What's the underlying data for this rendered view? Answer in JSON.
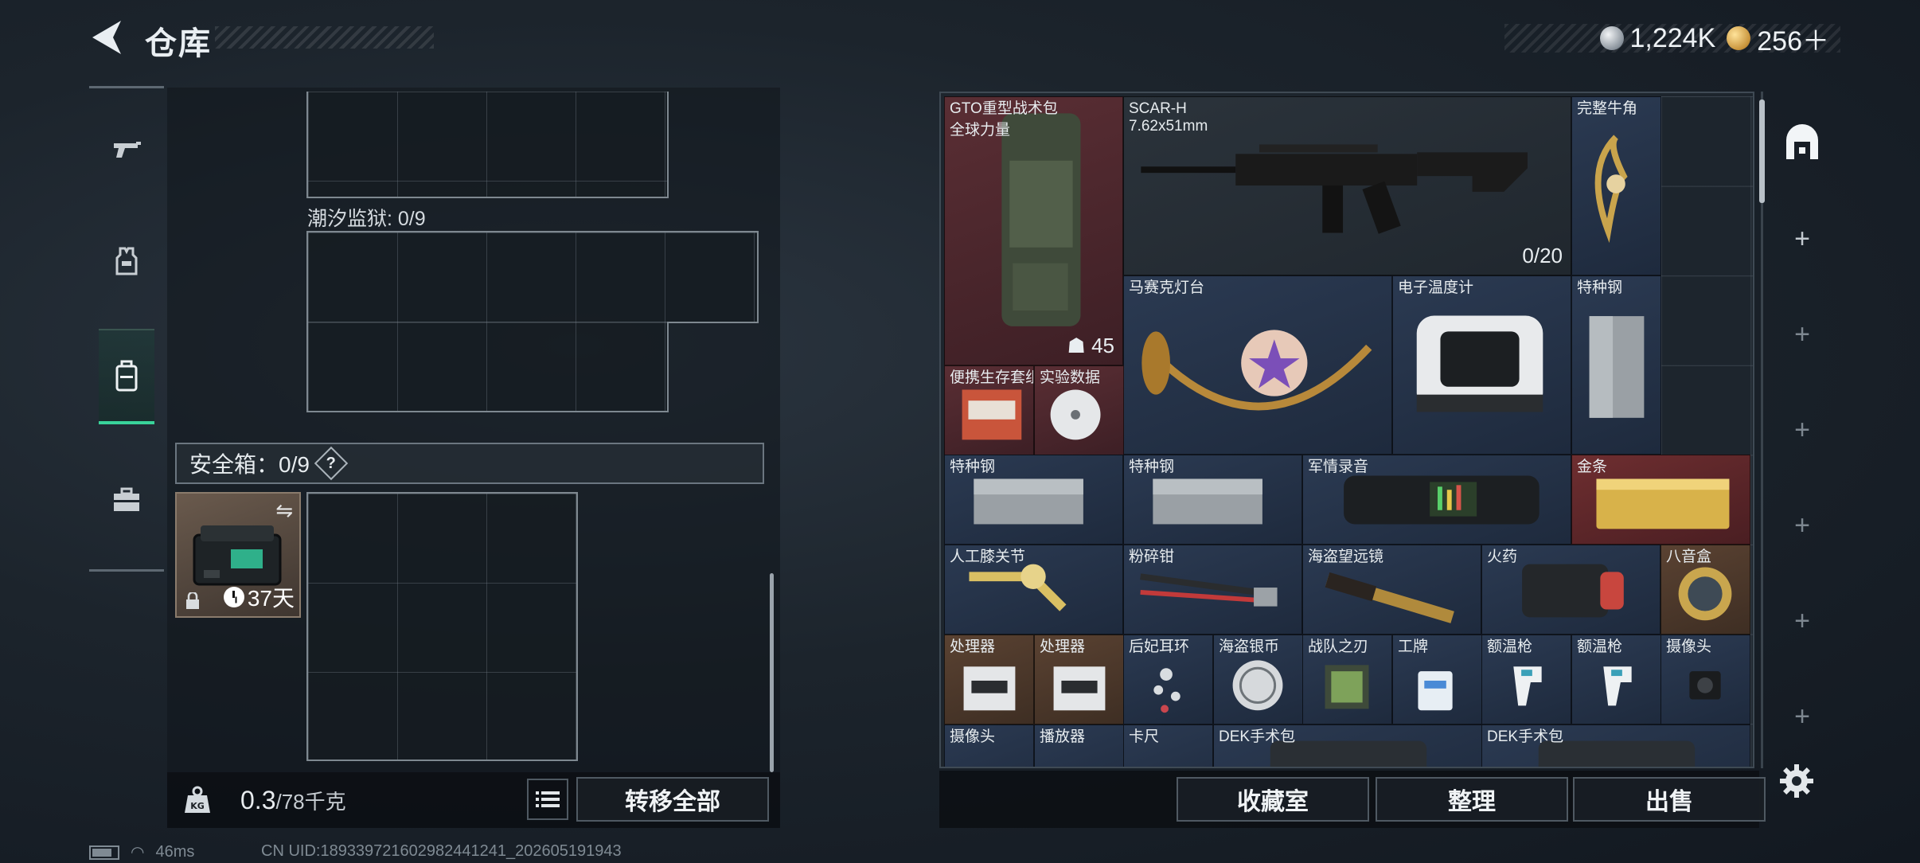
{
  "header": {
    "title": "仓库",
    "currency_silver": "1,224K",
    "currency_gold": "256＋"
  },
  "left_panel": {
    "container_label": "潮汐监狱: 0/9",
    "safebox_label": "安全箱：0/9",
    "safebox_help": "?",
    "safebox_timer": "37天",
    "weight_value": "0.3",
    "weight_unit": "/78千克",
    "transfer_all": "转移全部"
  },
  "inventory": {
    "items": [
      {
        "name": "GTO重型战术包",
        "sub": "全球力量",
        "count": "45",
        "quality": "red"
      },
      {
        "name": "SCAR-H",
        "sub": "7.62x51mm",
        "count": "0/20",
        "quality": "gray"
      },
      {
        "name": "完整牛角",
        "quality": "blue"
      },
      {
        "name": "马赛克灯台",
        "quality": "blue"
      },
      {
        "name": "电子温度计",
        "quality": "blue"
      },
      {
        "name": "特种钢",
        "quality": "blue"
      },
      {
        "name": "便携生存套组",
        "quality": "red"
      },
      {
        "name": "实验数据",
        "quality": "red"
      },
      {
        "name": "特种钢",
        "quality": "blue"
      },
      {
        "name": "特种钢",
        "quality": "blue"
      },
      {
        "name": "军情录音",
        "quality": "blue"
      },
      {
        "name": "金条",
        "quality": "red"
      },
      {
        "name": "人工膝关节",
        "quality": "blue"
      },
      {
        "name": "粉碎钳",
        "quality": "blue"
      },
      {
        "name": "海盗望远镜",
        "quality": "blue"
      },
      {
        "name": "火药",
        "quality": "blue"
      },
      {
        "name": "八音盒",
        "quality": "brown"
      },
      {
        "name": "处理器",
        "quality": "brown"
      },
      {
        "name": "处理器",
        "quality": "brown"
      },
      {
        "name": "后妃耳环",
        "quality": "blue"
      },
      {
        "name": "海盗银币",
        "quality": "blue"
      },
      {
        "name": "战队之刃",
        "quality": "blue"
      },
      {
        "name": "工牌",
        "quality": "blue"
      },
      {
        "name": "额温枪",
        "quality": "blue"
      },
      {
        "name": "额温枪",
        "quality": "blue"
      },
      {
        "name": "摄像头",
        "quality": "blue"
      },
      {
        "name": "摄像头",
        "quality": "blue"
      },
      {
        "name": "播放器",
        "quality": "blue"
      },
      {
        "name": "卡尺",
        "quality": "blue"
      },
      {
        "name": "DEK手术包",
        "quality": "blue"
      },
      {
        "name": "DEK手术包",
        "quality": "blue"
      }
    ]
  },
  "bottom_buttons": {
    "collection": "收藏室",
    "organize": "整理",
    "sell": "出售"
  },
  "footer": {
    "ping": "46ms",
    "uid": "CN UID:18933972160298244124​1_202605191943"
  },
  "colors": {
    "accent": "#39d39a",
    "quality_red": "#5a2e34",
    "quality_blue": "#2b3a52"
  }
}
